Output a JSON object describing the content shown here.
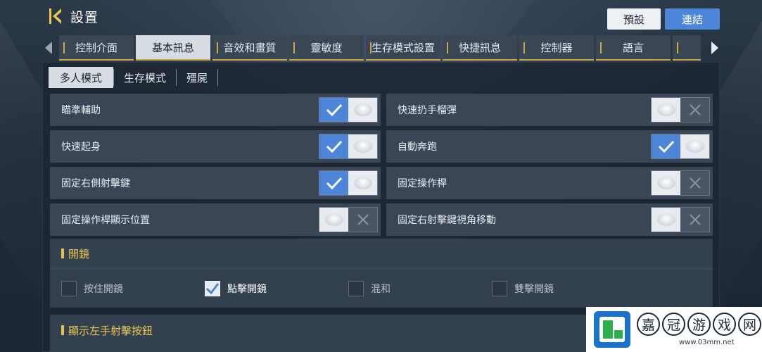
{
  "header": {
    "title": "設置"
  },
  "top_buttons": {
    "preset": "預設",
    "link": "連結"
  },
  "tabs": [
    {
      "label": "控制介面",
      "active": false
    },
    {
      "label": "基本訊息",
      "active": true
    },
    {
      "label": "音效和畫質",
      "active": false
    },
    {
      "label": "靈敏度",
      "active": false
    },
    {
      "label": "生存模式設置",
      "active": false
    },
    {
      "label": "快捷訊息",
      "active": false
    },
    {
      "label": "控制器",
      "active": false
    },
    {
      "label": "語言",
      "active": false
    },
    {
      "label": "",
      "active": false
    }
  ],
  "subtabs": [
    {
      "label": "多人模式",
      "active": true
    },
    {
      "label": "生存模式",
      "active": false
    },
    {
      "label": "殭屍",
      "active": false
    }
  ],
  "settings": [
    {
      "left": {
        "label": "瞄準輔助",
        "on": true
      },
      "right": {
        "label": "快速扔手榴彈",
        "on": false
      }
    },
    {
      "left": {
        "label": "快速起身",
        "on": true
      },
      "right": {
        "label": "自動奔跑",
        "on": true
      }
    },
    {
      "left": {
        "label": "固定右側射擊鍵",
        "on": true
      },
      "right": {
        "label": "固定操作桿",
        "on": false
      }
    },
    {
      "left": {
        "label": "固定操作桿顯示位置",
        "on": false
      },
      "right": {
        "label": "固定右射擊鍵視角移動",
        "on": false
      }
    }
  ],
  "scope_section": {
    "title": "開鏡",
    "options": [
      {
        "label": "按住開鏡",
        "checked": false
      },
      {
        "label": "點擊開鏡",
        "checked": true
      },
      {
        "label": "混和",
        "checked": false
      },
      {
        "label": "雙擊開鏡",
        "checked": false
      }
    ]
  },
  "left_fire_section": {
    "title": "顯示左手射擊按鈕"
  },
  "watermark": {
    "chars": [
      "嘉",
      "冠",
      "游",
      "戏",
      "网"
    ],
    "url": "www.03mm.net"
  },
  "colors": {
    "accent_blue": "#4d86d9",
    "accent_gold": "#e9c84f",
    "tab_underline": "#c9a84a"
  }
}
